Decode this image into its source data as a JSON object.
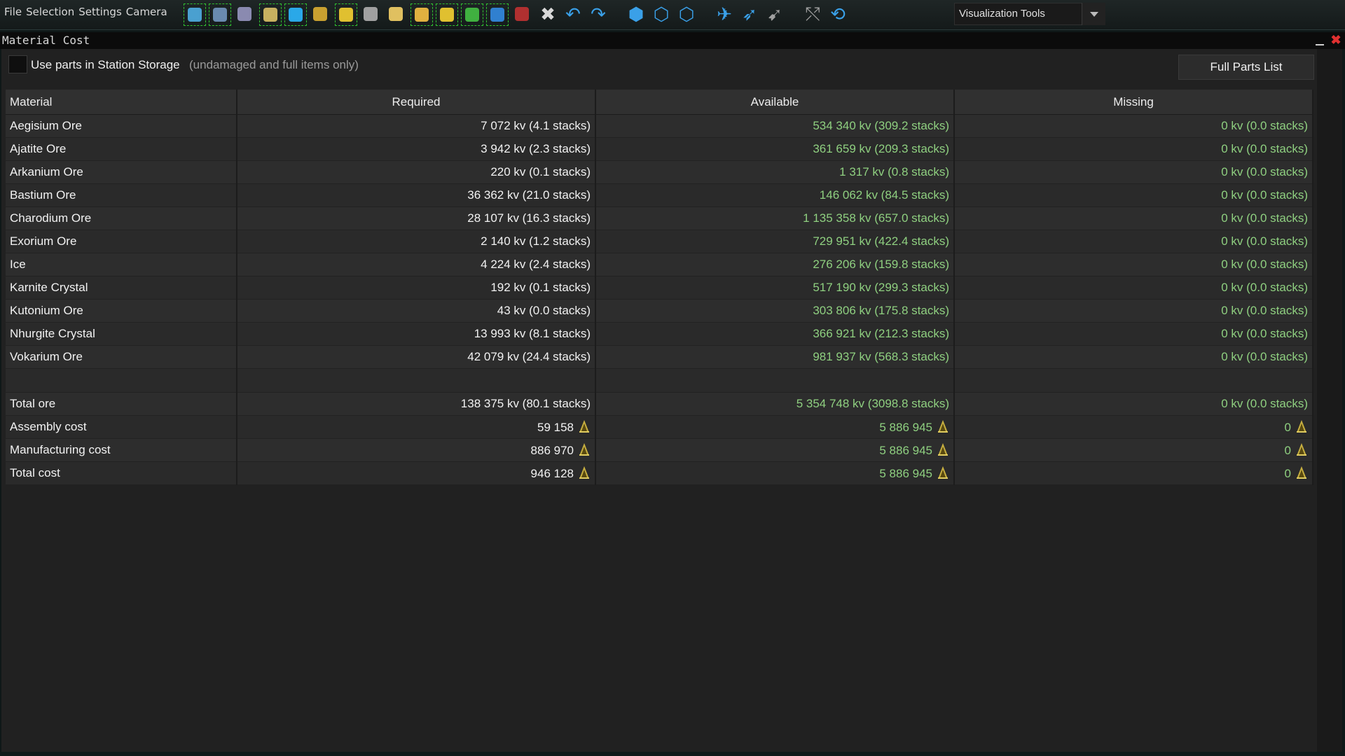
{
  "menu": [
    "File",
    "Selection",
    "Settings",
    "Camera"
  ],
  "toolbar_icons": [
    {
      "name": "blueprint-view-icon",
      "color": "#4aa0d0",
      "green": true
    },
    {
      "name": "wireframe-icon",
      "color": "#6a8ab0",
      "green": true
    },
    {
      "name": "tools-icon",
      "color": "#8a8ab0",
      "green": false
    },
    {
      "name": "list-icon",
      "color": "#c8b060",
      "green": true
    },
    {
      "name": "sphere-icon",
      "color": "#2aa8e8",
      "green": true
    },
    {
      "name": "layers-icon",
      "color": "#c8a030",
      "green": false
    },
    {
      "name": "chart-icon",
      "color": "#e0c030",
      "green": true
    },
    {
      "name": "grid-icon",
      "color": "#a0a0a0",
      "green": false
    },
    {
      "name": "parts-icon",
      "color": "#e0c060",
      "green": false
    },
    {
      "name": "paint-icon",
      "color": "#e0b040",
      "green": true
    },
    {
      "name": "pie-icon",
      "color": "#e0c030",
      "green": true
    },
    {
      "name": "lock-icon",
      "color": "#40b040",
      "green": true
    },
    {
      "name": "wrench-icon",
      "color": "#3080d0",
      "green": true
    },
    {
      "name": "save-icon",
      "color": "#b03030",
      "green": false
    }
  ],
  "vis_tools": {
    "label": "Visualization Tools"
  },
  "window": {
    "title": "Material Cost"
  },
  "storage": {
    "label": "Use parts in Station Storage",
    "note": "(undamaged and full items only)"
  },
  "full_parts_button": "Full Parts List",
  "table": {
    "headers": [
      "Material",
      "Required",
      "Available",
      "Missing"
    ],
    "rows": [
      [
        "Aegisium Ore",
        "7 072 kv (4.1 stacks)",
        "534 340 kv (309.2 stacks)",
        "0 kv (0.0 stacks)"
      ],
      [
        "Ajatite Ore",
        "3 942 kv (2.3 stacks)",
        "361 659 kv (209.3 stacks)",
        "0 kv (0.0 stacks)"
      ],
      [
        "Arkanium Ore",
        "220 kv (0.1 stacks)",
        "1 317 kv (0.8 stacks)",
        "0 kv (0.0 stacks)"
      ],
      [
        "Bastium Ore",
        "36 362 kv (21.0 stacks)",
        "146 062 kv (84.5 stacks)",
        "0 kv (0.0 stacks)"
      ],
      [
        "Charodium Ore",
        "28 107 kv (16.3 stacks)",
        "1 135 358 kv (657.0 stacks)",
        "0 kv (0.0 stacks)"
      ],
      [
        "Exorium Ore",
        "2 140 kv (1.2 stacks)",
        "729 951 kv (422.4 stacks)",
        "0 kv (0.0 stacks)"
      ],
      [
        "Ice",
        "4 224 kv (2.4 stacks)",
        "276 206 kv (159.8 stacks)",
        "0 kv (0.0 stacks)"
      ],
      [
        "Karnite Crystal",
        "192 kv (0.1 stacks)",
        "517 190 kv (299.3 stacks)",
        "0 kv (0.0 stacks)"
      ],
      [
        "Kutonium Ore",
        "43 kv (0.0 stacks)",
        "303 806 kv (175.8 stacks)",
        "0 kv (0.0 stacks)"
      ],
      [
        "Nhurgite Crystal",
        "13 993 kv (8.1 stacks)",
        "366 921 kv (212.3 stacks)",
        "0 kv (0.0 stacks)"
      ],
      [
        "Vokarium Ore",
        "42 079 kv (24.4 stacks)",
        "981 937 kv (568.3 stacks)",
        "0 kv (0.0 stacks)"
      ]
    ],
    "total_ore": [
      "Total ore",
      "138 375 kv (80.1 stacks)",
      "5 354 748 kv (3098.8 stacks)",
      "0 kv (0.0 stacks)"
    ],
    "costs": [
      [
        "Assembly cost",
        "59 158",
        "5 886 945",
        "0"
      ],
      [
        "Manufacturing cost",
        "886 970",
        "5 886 945",
        "0"
      ],
      [
        "Total cost",
        "946 128",
        "5 886 945",
        "0"
      ]
    ],
    "currency_icon": "credits-icon"
  }
}
